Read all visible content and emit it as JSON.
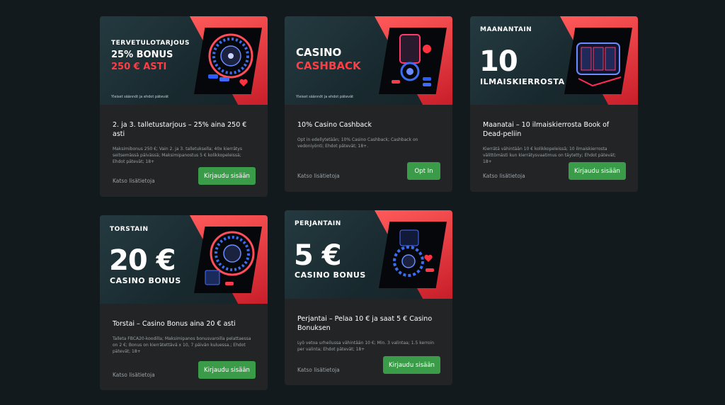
{
  "cards": [
    {
      "banner": {
        "kicker": "TERVETULOTARJOUS",
        "line1": "25% BONUS",
        "line2": "250 € ASTI",
        "terms": "Yleiset säännöt ja ehdot pätevät"
      },
      "title": "2. ja 3. talletustarjous – 25% aina 250 € asti",
      "desc": "Maksimibonus 250 €; Vain 2. ja 3. talletuksella; 40x kierrätys seitsemässä päivässä; Maksimipanostus 5 € kolikkopeleissä; Ehdot pätevät; 18+",
      "more": "Katso lisätietoja",
      "button": "Kirjaudu sisään"
    },
    {
      "banner": {
        "line1": "CASINO",
        "line2": "CASHBACK",
        "terms": "Yleiset säännöt ja ehdot pätevät"
      },
      "title": "10% Casino Cashback",
      "desc": "Opt in edellytetään; 10% Casino Cashback; Cashback on vedoniyönti; Ehdot pätevät; 18+.",
      "more": "Katso lisätietoja",
      "button": "Opt In"
    },
    {
      "banner": {
        "kicker": "MAANANTAIN",
        "big": "10",
        "sub": "ILMAISKIERROSTA"
      },
      "title": "Maanatai – 10 ilmaiskierrosta Book of Dead-peliin",
      "desc": "Kierrätä vähintään 10 € kolikkopeleissä; 10 ilmaiskierrosta välittömästi kun kierrätysvaatimus on täytetty; Ehdot pätevät; 18+",
      "more": "Katso lisätietoja",
      "button": "Kirjaudu sisään"
    },
    {
      "banner": {
        "kicker": "TORSTAIN",
        "big": "20 €",
        "sub": "CASINO BONUS"
      },
      "title": "Torstai – Casino Bonus aina 20 € asti",
      "desc": "Talleta FBCA20-koodilla; Maksimipanos bonusvaroilla pelattaessa on 2 €; Bonus on kierrätettävä x 10, 7 päivän kuluessa.; Ehdot pätevät; 18+",
      "more": "Katso lisätietoja",
      "button": "Kirjaudu sisään"
    },
    {
      "banner": {
        "kicker": "PERJANTAIN",
        "big": "5 €",
        "sub": "CASINO BONUS"
      },
      "title": "Perjantai – Pelaa 10 € ja saat 5 € Casino Bonuksen",
      "desc": "Lyö vetoa urheilussa vähintään 10 €; Min. 3 valintaa; 1.5 kerroin per valinta; Ehdot pätevät; 18+",
      "more": "Katso lisätietoja",
      "button": "Kirjaudu sisään"
    }
  ]
}
